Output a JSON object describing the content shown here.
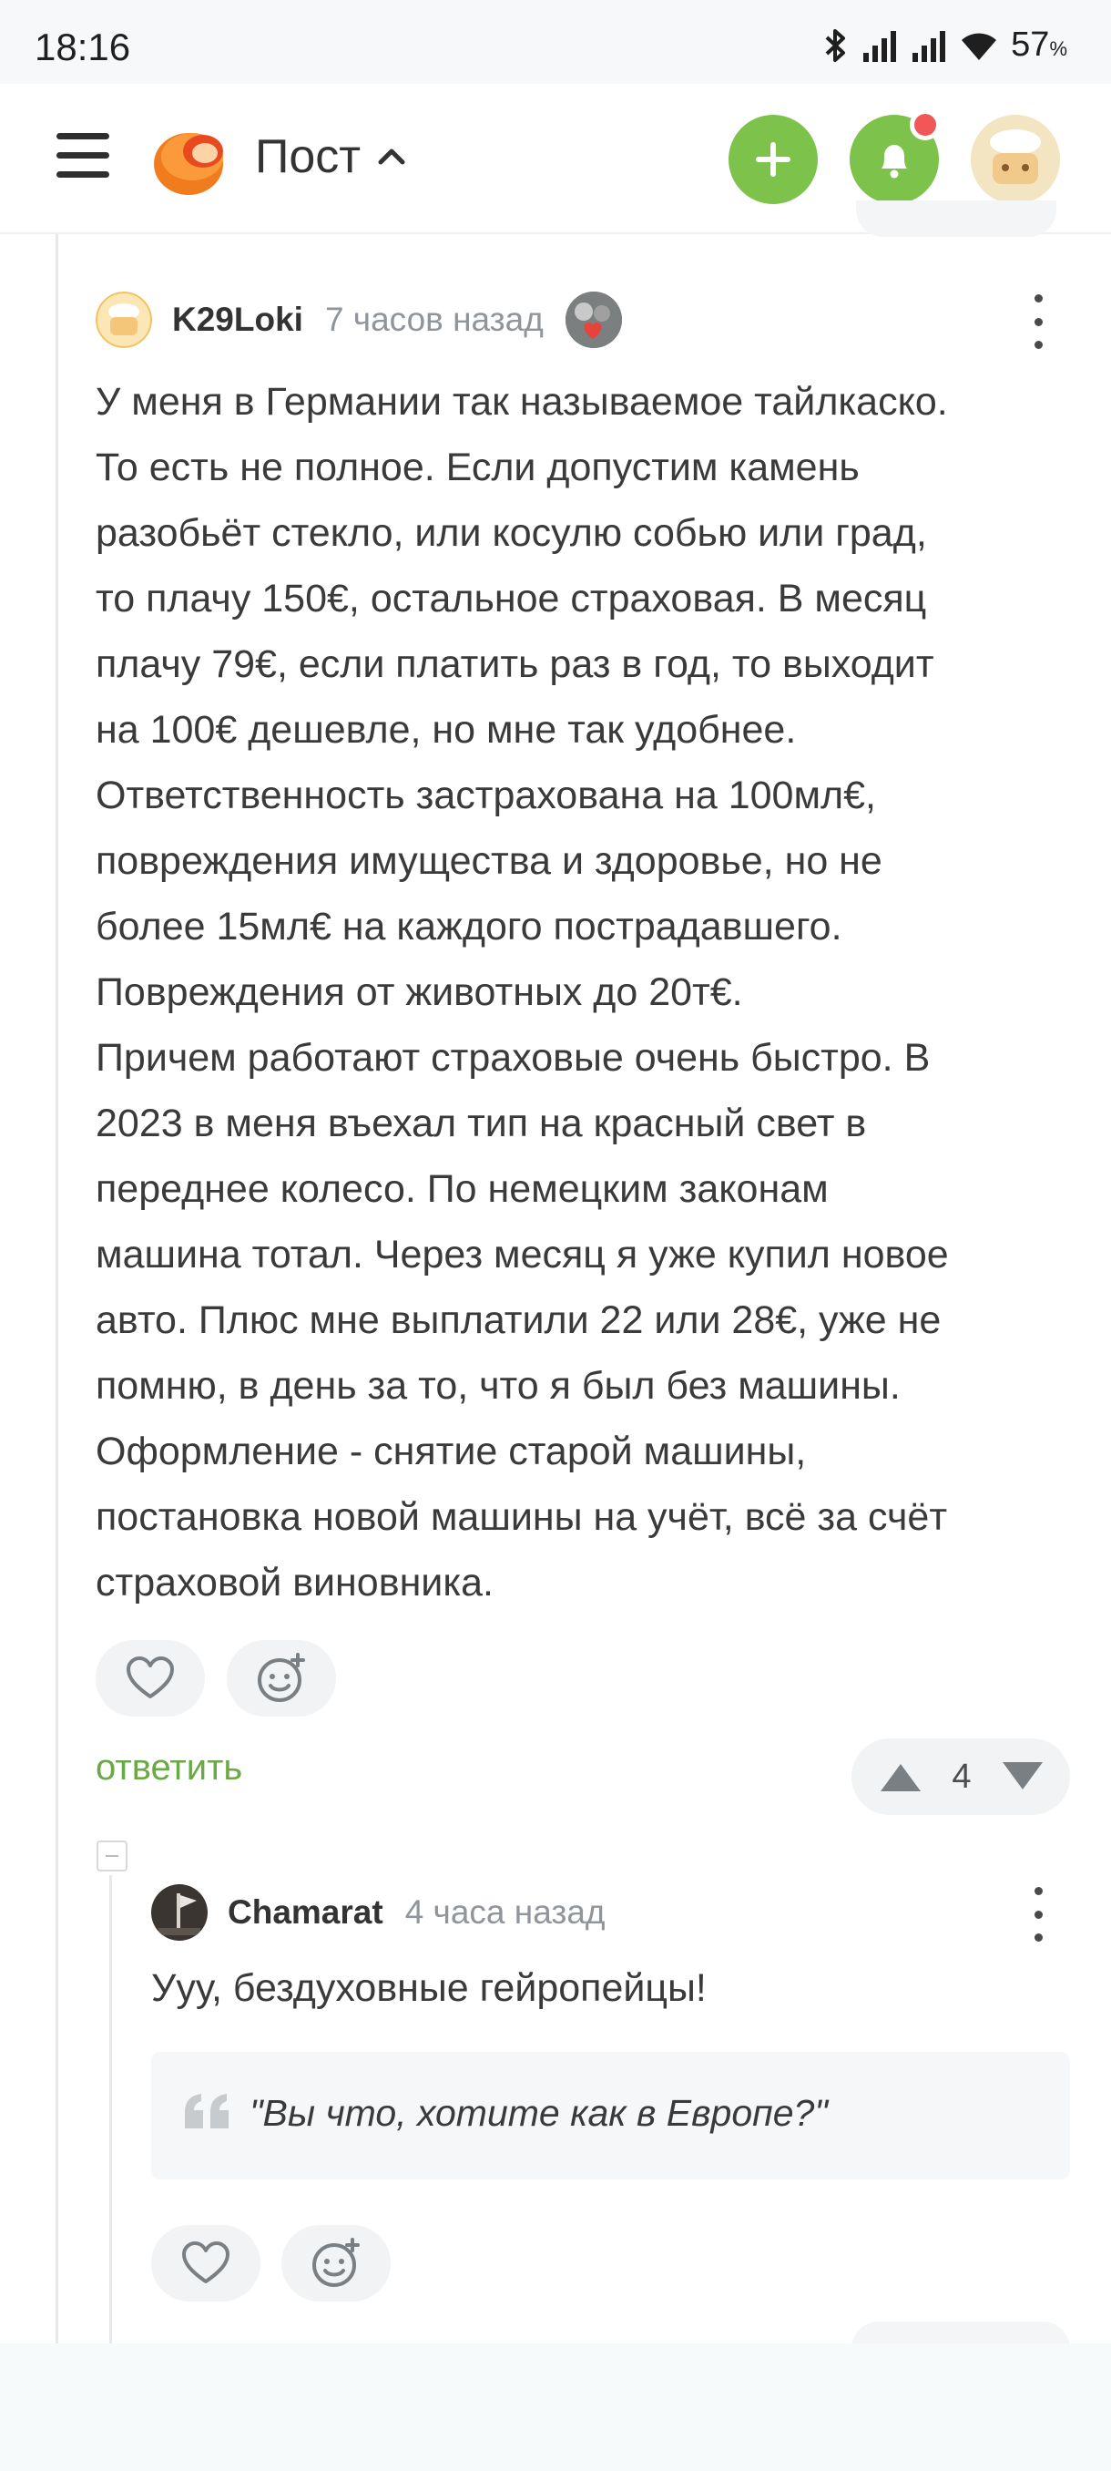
{
  "status_bar": {
    "time": "18:16",
    "battery": "57",
    "battery_unit": "%"
  },
  "header": {
    "title": "Пост",
    "icons": [
      "menu-icon",
      "logo",
      "chevron-up-icon",
      "plus-icon",
      "bell-icon",
      "avatar"
    ],
    "accent_color": "#7cc24b",
    "notification_dot_color": "#f25757"
  },
  "comment": {
    "user": "K29Loki",
    "time": "7 часов назад",
    "text": "У меня в Германии так называемое тайлкаско.\nТо есть не полное. Если допустим камень\nразобьёт стекло, или косулю собью или град,\nто плачу 150€, остальное страховая. В месяц\nплачу 79€, если платить раз в год, то выходит\nна 100€ дешевле, но мне так удобнее.\nОтветственность застрахована на 100мл€,\nповреждения имущества и здоровье, но не\nболее 15мл€ на каждого пострадавшего.\nПовреждения от животных до 20т€.\nПричем работают страховые очень быстро. В\n2023 в меня въехал тип на красный свет в\nпереднее колесо. По немецким законам\nмашина тотал. Через месяц я уже купил новое\nавто. Плюс мне выплатили 22 или 28€, уже не\nпомню, в день за то, что я был без машины.\nОформление - снятие старой машины,\nпостановка новой машины на учёт, всё за счёт\nстраховой виновника.",
    "reply_label": "ответить",
    "rating": "4"
  },
  "reply_comment": {
    "user": "Chamarat",
    "time": "4 часа назад",
    "text": "Ууу, бездуховные гейропейцы!",
    "quote": "\"Вы что, хотите как в Европе?\""
  }
}
